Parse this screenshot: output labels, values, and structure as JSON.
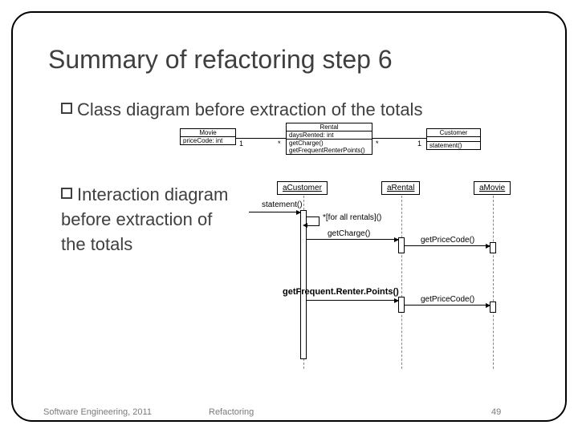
{
  "title": "Summary of refactoring step 6",
  "bullets": {
    "b1": "Class diagram before  extraction of the totals",
    "b2a": "Interaction diagram",
    "b2b": "before extraction of",
    "b2c": "the totals"
  },
  "class_diagram": {
    "movie": {
      "name": "Movie",
      "attr": "priceCode: int"
    },
    "rental": {
      "name": "Rental",
      "attr": "daysRented: int",
      "op1": "getCharge()",
      "op2": "getFrequentRenterPoints()"
    },
    "customer": {
      "name": "Customer",
      "op": "statement()"
    },
    "mult_1a": "1",
    "mult_star1": "*",
    "mult_star2": "*",
    "mult_1b": "1"
  },
  "seq": {
    "objs": {
      "cust": "aCustomer",
      "rent": "aRental",
      "mov": "aMovie"
    },
    "msgs": {
      "statement": "statement()",
      "loop": "*[for all rentals]()",
      "getCharge": "getCharge()",
      "getPriceCode1": "getPriceCode()",
      "getFreq": "getFrequent.Renter.Points()",
      "getPriceCode2": "getPriceCode()"
    }
  },
  "footer": {
    "left": "Software Engineering, 2011",
    "mid": "Refactoring",
    "page": "49"
  }
}
